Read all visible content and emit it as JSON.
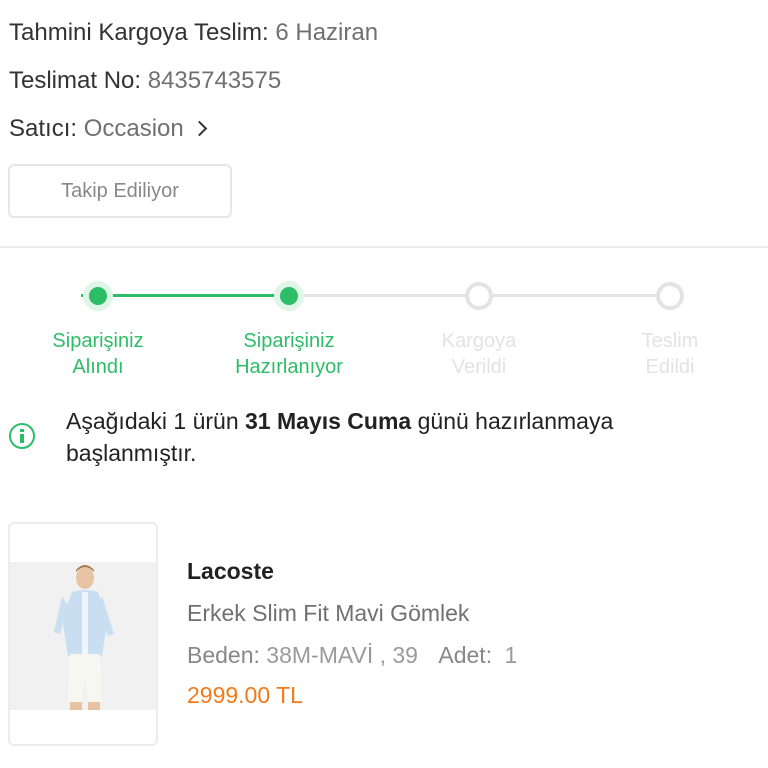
{
  "delivery": {
    "estimated_label": "Tahmini Kargoya Teslim:",
    "estimated_value": "6 Haziran",
    "number_label": "Teslimat No:",
    "number_value": "8435743575",
    "seller_label": "Satıcı:",
    "seller_value": "Occasion"
  },
  "track_button": "Takip Ediliyor",
  "steps": [
    {
      "line1": "Siparişiniz",
      "line2": "Alındı",
      "state": "done"
    },
    {
      "line1": "Siparişiniz",
      "line2": "Hazırlanıyor",
      "state": "done"
    },
    {
      "line1": "Kargoya",
      "line2": "Verildi",
      "state": "todo"
    },
    {
      "line1": "Teslim",
      "line2": "Edildi",
      "state": "todo"
    }
  ],
  "notice": {
    "part1": "Aşağıdaki 1 ürün ",
    "bold": "31 Mayıs Cuma",
    "part2": " günü hazırlanmaya başlanmıştır."
  },
  "product": {
    "brand": "Lacoste",
    "name": "Erkek Slim Fit Mavi Gömlek",
    "size_label": "Beden:",
    "size_value": "38M-MAVİ , 39",
    "qty_label": "Adet:",
    "qty_value": "1",
    "price": "2999.00 TL",
    "image_icon": "product-photo"
  },
  "colors": {
    "green": "#2dbd68",
    "orange": "#f27a1a"
  }
}
